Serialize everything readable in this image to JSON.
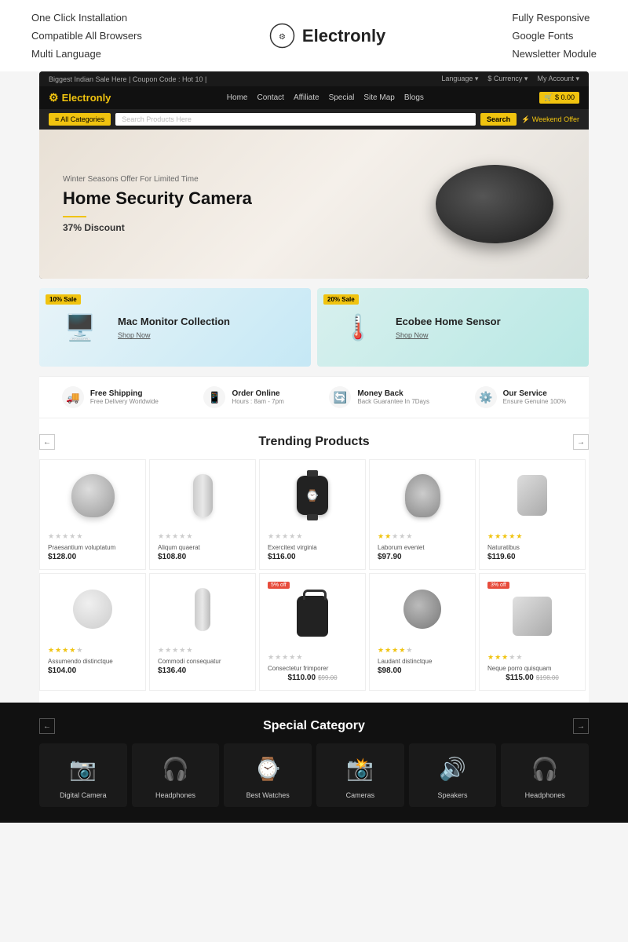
{
  "feature_bar": {
    "left_items": [
      "One Click Installation",
      "Compatible All Browsers",
      "Multi Language"
    ],
    "right_items": [
      "Fully Responsive",
      "Google Fonts",
      "Newsletter Module"
    ],
    "logo": "Electronly"
  },
  "mockup": {
    "topbar": {
      "left": "Biggest Indian Sale Here | Coupon Code : Hot 10 |",
      "right_items": [
        "Language",
        "$ Currency",
        "My Account"
      ]
    },
    "nav": {
      "logo": "Electronly",
      "links": [
        "Home",
        "Contact",
        "Affiliate",
        "Special",
        "Site Map",
        "Blogs"
      ],
      "cart": "$ 0.00"
    },
    "search": {
      "categories": "≡  All Categories",
      "placeholder": "Search Products Here",
      "button": "Search",
      "offer": "⚡ Weekend Offer"
    },
    "hero": {
      "subtitle": "Winter Seasons Offer For Limited Time",
      "title": "Home Security Camera",
      "discount": "37% Discount"
    },
    "promo_cards": [
      {
        "badge": "10% Sale",
        "title": "Mac Monitor Collection",
        "shop": "Shop Now",
        "type": "monitor"
      },
      {
        "badge": "20% Sale",
        "title": "Ecobee Home Sensor",
        "shop": "Shop Now",
        "type": "ecobee"
      }
    ],
    "features": [
      {
        "icon": "🚚",
        "main": "Free Shipping",
        "sub": "Free Delivery Worldwide"
      },
      {
        "icon": "📱",
        "main": "Order Online",
        "sub": "Hours : 8am - 7pm"
      },
      {
        "icon": "🔄",
        "main": "Money Back",
        "sub": "Back Guarantee In 7Days"
      },
      {
        "icon": "⚙️",
        "main": "Our Service",
        "sub": "Ensure Genuine 100%"
      }
    ],
    "trending": {
      "title": "Trending Products",
      "products_row1": [
        {
          "name": "Praesantium voluptatum",
          "price": "$128.00",
          "stars": 0,
          "type": "dome"
        },
        {
          "name": "Aliqum  quaerat",
          "price": "$108.80",
          "stars": 0,
          "type": "cylinder"
        },
        {
          "name": "Exercitext virginia",
          "price": "$116.00",
          "stars": 0,
          "type": "watch"
        },
        {
          "name": "Laborum eveniet",
          "price": "$97.90",
          "stars": 2,
          "type": "camera360"
        },
        {
          "name": "Naturatibus",
          "price": "$119.60",
          "stars": 5,
          "type": "smallcam"
        }
      ],
      "products_row2": [
        {
          "name": "Assumendo distinctque",
          "price": "$104.00",
          "stars": 4,
          "badge": "",
          "type": "speaker_white"
        },
        {
          "name": "Commodi consequatur",
          "price": "$136.40",
          "stars": 0,
          "badge": "",
          "type": "tower_speaker"
        },
        {
          "name": "Consectetur frimporer",
          "price": "$110.00",
          "price_old": "$99.00",
          "stars": 0,
          "badge": "5% off",
          "type": "bag"
        },
        {
          "name": "Laudant distinctque",
          "price": "$98.00",
          "stars": 4,
          "badge": "",
          "type": "360cam"
        },
        {
          "name": "Neque porro quisquam",
          "price": "$115.00",
          "price_old": "$198.00",
          "stars": 3,
          "badge": "3% off",
          "type": "speaker_round"
        }
      ]
    },
    "special": {
      "title": "Special Category",
      "categories": [
        {
          "name": "Digital Camera",
          "icon": "📷"
        },
        {
          "name": "Headphones",
          "icon": "🎧"
        },
        {
          "name": "Best Watches",
          "icon": "⌚"
        },
        {
          "name": "Cameras",
          "icon": "📸"
        },
        {
          "name": "Speakers",
          "icon": "🔊"
        },
        {
          "name": "Headphones",
          "icon": "🎧"
        }
      ]
    }
  }
}
